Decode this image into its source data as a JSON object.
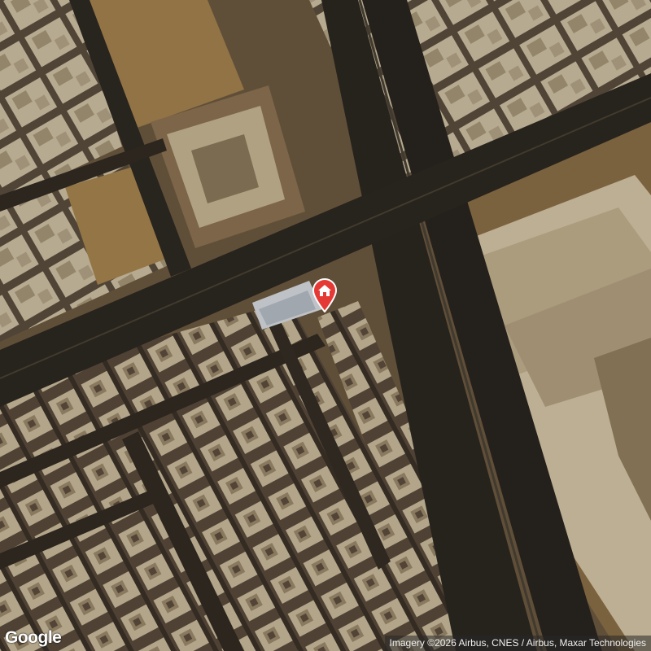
{
  "map": {
    "type": "satellite",
    "logo_text": "Google",
    "attribution": "Imagery ©2026 Airbus, CNES / Airbus, Maxar Technologies",
    "marker": {
      "icon": "home-icon",
      "color": "#e53935"
    }
  },
  "colors": {
    "road": "#2c2822",
    "ground": "#8a6a40",
    "roof": "#d8c9a8",
    "marker": "#e53935"
  }
}
